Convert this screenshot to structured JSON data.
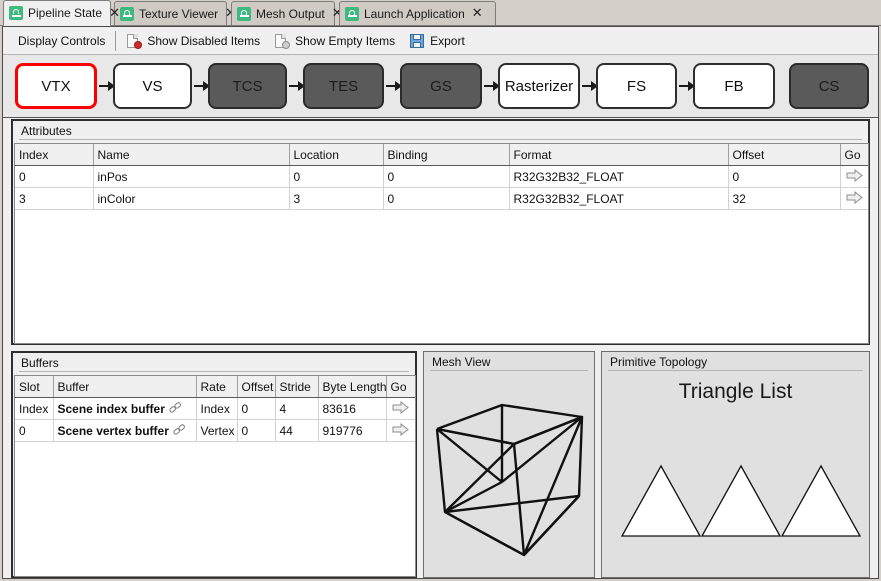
{
  "tabs": [
    {
      "label": "Pipeline State",
      "icon": "renderdoc-icon",
      "active": true,
      "close": "✕"
    },
    {
      "label": "Texture Viewer",
      "icon": "renderdoc-icon",
      "active": false,
      "close": "✕"
    },
    {
      "label": "Mesh Output",
      "icon": "renderdoc-icon",
      "active": false,
      "close": "✕"
    },
    {
      "label": "Launch Application",
      "icon": "renderdoc-icon",
      "active": false,
      "close": "✕"
    }
  ],
  "toolbar": {
    "display_controls": "Display Controls",
    "show_disabled_items": "Show Disabled Items",
    "show_empty_items": "Show Empty Items",
    "export": "Export"
  },
  "pipeline": {
    "stages": [
      {
        "label": "VTX",
        "state": "selected"
      },
      {
        "label": "VS",
        "state": "enabled"
      },
      {
        "label": "TCS",
        "state": "disabled"
      },
      {
        "label": "TES",
        "state": "disabled"
      },
      {
        "label": "GS",
        "state": "disabled"
      },
      {
        "label": "Rasterizer",
        "state": "enabled"
      },
      {
        "label": "FS",
        "state": "enabled"
      },
      {
        "label": "FB",
        "state": "enabled"
      },
      {
        "label": "CS",
        "state": "disabled"
      }
    ]
  },
  "attributes": {
    "title": "Attributes",
    "columns": [
      "Index",
      "Name",
      "Location",
      "Binding",
      "Format",
      "Offset",
      "Go"
    ],
    "rows": [
      {
        "index": "0",
        "name": "inPos",
        "location": "0",
        "binding": "0",
        "format": "R32G32B32_FLOAT",
        "offset": "0",
        "go": "go-arrow-icon"
      },
      {
        "index": "3",
        "name": "inColor",
        "location": "3",
        "binding": "0",
        "format": "R32G32B32_FLOAT",
        "offset": "32",
        "go": "go-arrow-icon"
      }
    ]
  },
  "buffers": {
    "title": "Buffers",
    "columns": [
      "Slot",
      "Buffer",
      "Rate",
      "Offset",
      "Stride",
      "Byte Length",
      "Go"
    ],
    "rows": [
      {
        "slot": "Index",
        "buffer": "Scene index buffer",
        "rate": "Index",
        "offset": "0",
        "stride": "4",
        "byte_length": "83616",
        "go": "go-arrow-icon"
      },
      {
        "slot": "0",
        "buffer": "Scene vertex buffer",
        "rate": "Vertex",
        "offset": "0",
        "stride": "44",
        "byte_length": "919776",
        "go": "go-arrow-icon"
      }
    ]
  },
  "mesh_view": {
    "title": "Mesh View",
    "preview": "wireframe-cube"
  },
  "primitive_topology": {
    "title": "Primitive Topology",
    "value": "Triangle List",
    "shape_count": 3
  },
  "colors": {
    "accent_green": "#3fb980",
    "selected_red": "#ff0000",
    "disabled_gray": "#5a5a5a",
    "panel_bg": "#e0e0e0",
    "window_bg": "#d4d0c8"
  }
}
